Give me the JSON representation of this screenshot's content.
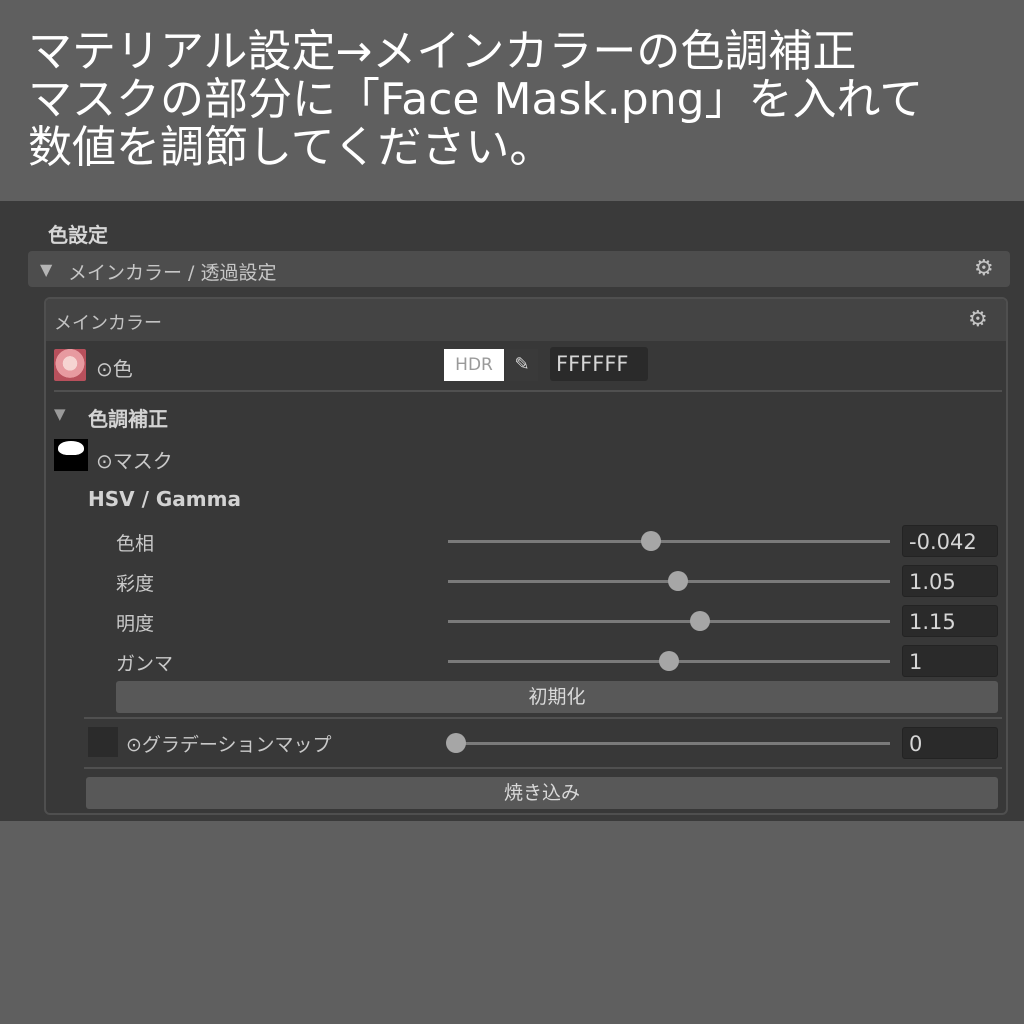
{
  "caption": {
    "line1": "マテリアル設定→メインカラーの色調補正",
    "line2": "マスクの部分に「Face Mask.png」を入れて",
    "line3": "数値を調節してください。"
  },
  "inspector": {
    "section_title": "色設定",
    "foldout_label": "メインカラー / 透過設定",
    "panel_title": "メインカラー",
    "color_row": {
      "label": "⊙色",
      "hdr_label": "HDR",
      "hex_value": "FFFFFF"
    },
    "color_correction": {
      "title": "色調補正",
      "mask_label": "⊙マスク",
      "hsv_title": "HSV / Gamma",
      "sliders": [
        {
          "label": "色相",
          "value": "-0.042",
          "fraction": 0.46
        },
        {
          "label": "彩度",
          "value": "1.05",
          "fraction": 0.52
        },
        {
          "label": "明度",
          "value": "1.15",
          "fraction": 0.57
        },
        {
          "label": "ガンマ",
          "value": "1",
          "fraction": 0.5
        }
      ],
      "reset_button": "初期化"
    },
    "gradation": {
      "label": "⊙グラデーションマップ",
      "value": "0",
      "fraction": 0.0
    },
    "bake_button": "焼き込み"
  },
  "icons": {
    "foldout": "triangle-down-icon",
    "gear": "gear-icon",
    "picker": "eyedropper-icon"
  },
  "colors": {
    "background": "#5f5f5f",
    "panel": "#3a3a3a",
    "caption_text": "#ffffff"
  }
}
